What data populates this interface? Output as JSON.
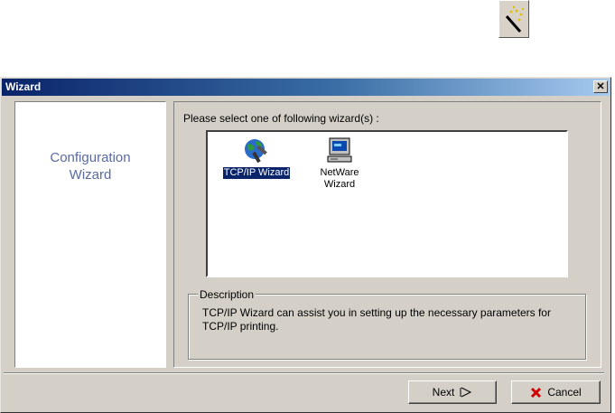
{
  "toolbar": {
    "wand_icon": "magic-wand-icon"
  },
  "window": {
    "title": "Wizard",
    "close_label": "✕",
    "left_panel": {
      "line1": "Configuration",
      "line2": "Wizard"
    },
    "prompt": "Please select one of following wizard(s) :",
    "wizards": [
      {
        "label": "TCP/IP Wizard",
        "icon": "globe-tools-icon",
        "selected": true
      },
      {
        "label_line1": "NetWare",
        "label_line2": "Wizard",
        "icon": "computer-icon",
        "selected": false
      }
    ],
    "description": {
      "legend": "Description",
      "text": "TCP/IP Wizard can assist you in setting up the necessary parameters for TCP/IP printing."
    },
    "buttons": {
      "next": "Next",
      "cancel": "Cancel"
    }
  },
  "colors": {
    "titlebar_start": "#0a246a",
    "titlebar_end": "#a6caf0",
    "panel": "#d4d0c8",
    "accent_text": "#5a6aa0"
  }
}
